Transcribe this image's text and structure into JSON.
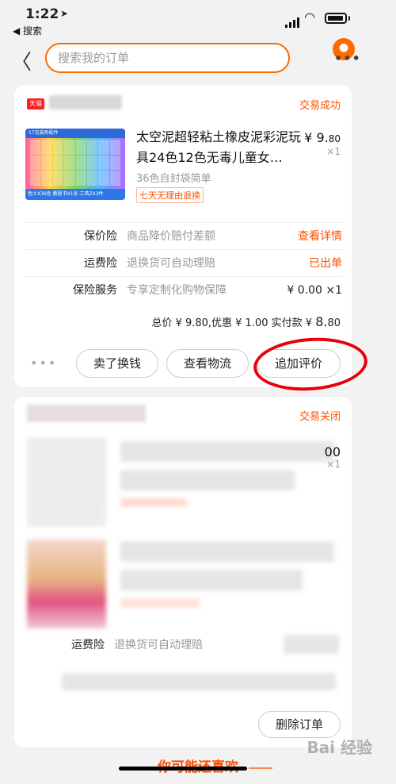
{
  "status_bar": {
    "time": "1:22",
    "back_app": "◀ 搜索"
  },
  "nav": {
    "search_placeholder": "搜索我的订单",
    "more_icon": "…"
  },
  "order1": {
    "status": "交易成功",
    "shop_logo_text": "天猫",
    "thumb_top_text": "17克装附配件",
    "thumb_bottom_text": "色土X36色 教程书X1张 工具ZX3件",
    "title": "太空泥超轻粘土橡皮泥彩泥玩具24色12色无毒儿童女…",
    "price_symbol": "¥",
    "price_int": "9.",
    "price_dec": "80",
    "qty": "×1",
    "sku": "36色自封袋简单",
    "tag": "七天无理由退换",
    "insurance": [
      {
        "label": "保价险",
        "desc": "商品降价赔付差额",
        "action": "查看详情",
        "action_color": "#ff5000"
      },
      {
        "label": "运费险",
        "desc": "退换货可自动理赔",
        "action": "已出单",
        "action_color": "#ff5000"
      },
      {
        "label": "保险服务",
        "desc": "专享定制化购物保障",
        "action": "¥ 0.00 ×1",
        "action_color": "#222222"
      }
    ],
    "total_prefix": "总价 ¥ 9.80,优惠 ¥ 1.00 实付款 ¥",
    "total_int": "8.",
    "total_dec": "80",
    "more_dots": "•••",
    "buttons": {
      "sell": "卖了换钱",
      "logistics": "查看物流",
      "review": "追加评价"
    }
  },
  "order2": {
    "status": "交易关闭",
    "partial_price": "00",
    "qty": "×1",
    "shipping_label": "运费险",
    "shipping_desc": "退换货可自动理赔",
    "delete_button": "删除订单"
  },
  "recommend": {
    "heading": "你可能还喜欢"
  },
  "watermark": "Bai 经验"
}
